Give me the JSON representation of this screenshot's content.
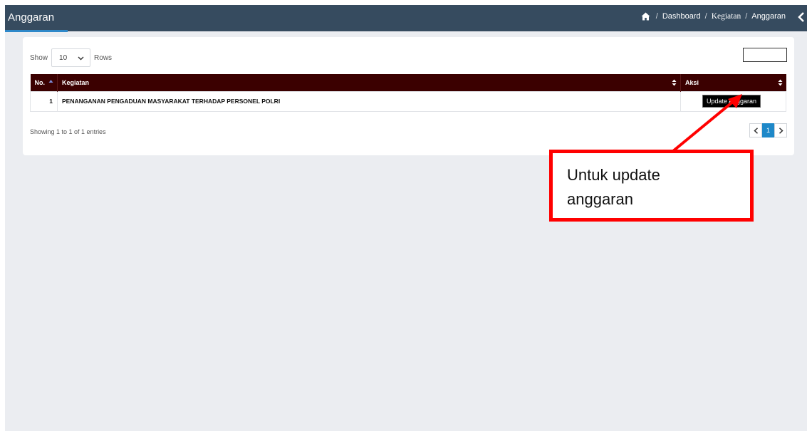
{
  "header": {
    "title": "Anggaran",
    "breadcrumb": [
      "Dashboard",
      "Kegiatan",
      "Anggaran"
    ],
    "separator": "/",
    "home_icon": "home-icon",
    "collapse_icon": "chevron-left-icon"
  },
  "table_controls": {
    "show_label": "Show",
    "rows_value": "10",
    "rows_label": "Rows",
    "search_value": ""
  },
  "table": {
    "columns": [
      "No.",
      "Kegiatan",
      "Aksi"
    ],
    "rows": [
      {
        "no": "1",
        "kegiatan": "PENANGANAN PENGADUAN MASYARAKAT TERHADAP PERSONEL POLRI",
        "action_label": "Update Anggaran"
      }
    ],
    "header_bg": "#3b0000"
  },
  "footer": {
    "info": "Showing 1 to 1 of 1 entries",
    "pages": [
      "1"
    ],
    "active_page": "1"
  },
  "annotation": {
    "lines": [
      "Untuk update",
      "anggaran"
    ],
    "color": "#ff0000"
  },
  "colors": {
    "topbar": "#364b5f",
    "accent": "#1e88c8",
    "background": "#ebedf1"
  }
}
